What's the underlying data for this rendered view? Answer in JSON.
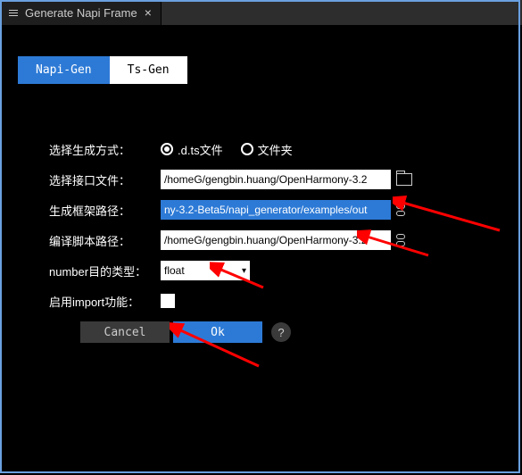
{
  "tab": {
    "title": "Generate Napi Frame"
  },
  "modeTabs": {
    "active": "Napi-Gen",
    "inactive": "Ts-Gen"
  },
  "labels": {
    "genMode": "选择生成方式：",
    "intfFile": "选择接口文件：",
    "framePath": "生成框架路径：",
    "scriptPath": "编译脚本路径：",
    "numberType": "number目的类型：",
    "enableImport": "启用import功能："
  },
  "radios": {
    "dtsFile": ".d.ts文件",
    "folder": "文件夹"
  },
  "inputs": {
    "intfFile": "/homeG/gengbin.huang/OpenHarmony-3.2",
    "framePath": "ny-3.2-Beta5/napi_generator/examples/out",
    "scriptPath": "/homeG/gengbin.huang/OpenHarmony-3.2"
  },
  "select": {
    "value": "float"
  },
  "buttons": {
    "cancel": "Cancel",
    "ok": "Ok",
    "help": "?"
  }
}
